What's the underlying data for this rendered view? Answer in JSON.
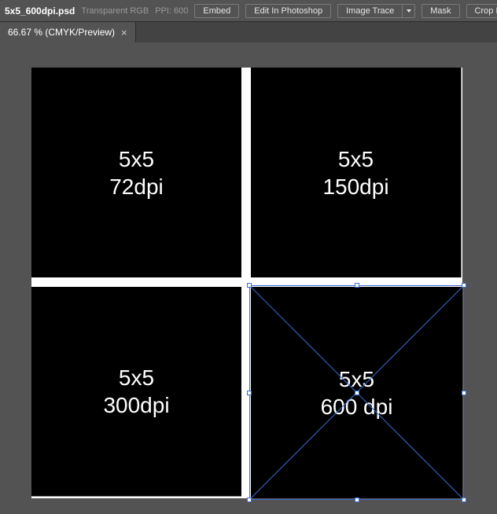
{
  "top_bar": {
    "filename": "5x5_600dpi.psd",
    "meta_mode": "Transparent RGB",
    "meta_ppi_label": "PPI:",
    "meta_ppi_value": "600",
    "buttons": {
      "embed": "Embed",
      "edit_ps": "Edit In Photoshop",
      "image_trace": "Image Trace",
      "mask": "Mask",
      "crop_image": "Crop Imag"
    }
  },
  "tab": {
    "label": "66.67 % (CMYK/Preview)"
  },
  "quads": {
    "tl": {
      "line1": "5x5",
      "line2": "72dpi"
    },
    "tr": {
      "line1": "5x5",
      "line2": "150dpi"
    },
    "bl": {
      "line1": "5x5",
      "line2": "300dpi"
    },
    "br": {
      "line1": "5x5",
      "line2": "600 dpi"
    }
  }
}
